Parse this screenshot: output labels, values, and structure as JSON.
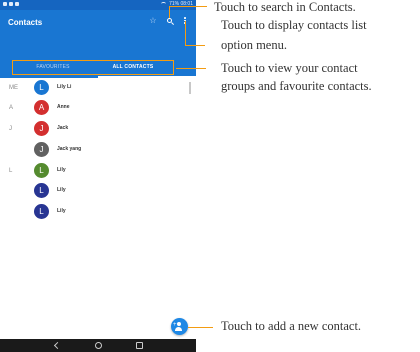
{
  "phone": {
    "statusbar": {
      "right_text": "71% 08:01"
    },
    "appbar": {
      "title": "Contacts"
    },
    "tabs": [
      {
        "label": "FAVOURITES",
        "active": false
      },
      {
        "label": "ALL CONTACTS",
        "active": true
      }
    ],
    "contacts": [
      {
        "section": "ME",
        "initial": "L",
        "name": "Lily Li",
        "color": "#1976d2"
      },
      {
        "section": "A",
        "initial": "A",
        "name": "Anne",
        "color": "#d32f2f"
      },
      {
        "section": "J",
        "initial": "J",
        "name": "Jack",
        "color": "#d32f2f"
      },
      {
        "section": "",
        "initial": "J",
        "name": "Jack yang",
        "color": "#616161"
      },
      {
        "section": "L",
        "initial": "L",
        "name": "Lily",
        "color": "#558b2f"
      },
      {
        "section": "",
        "initial": "L",
        "name": "Lily",
        "color": "#283593"
      },
      {
        "section": "",
        "initial": "L",
        "name": "Lily",
        "color": "#283593"
      }
    ]
  },
  "callouts": {
    "search": "Touch to search in Contacts.",
    "menu_line1": "Touch to display contacts list",
    "menu_line2": "option menu.",
    "tabs_line1": "Touch to view your contact",
    "tabs_line2": "groups and favourite contacts.",
    "add": "Touch to add a new contact."
  },
  "colors": {
    "accent": "#f39c12",
    "appbar": "#1976d2",
    "fab": "#1e88e5"
  }
}
